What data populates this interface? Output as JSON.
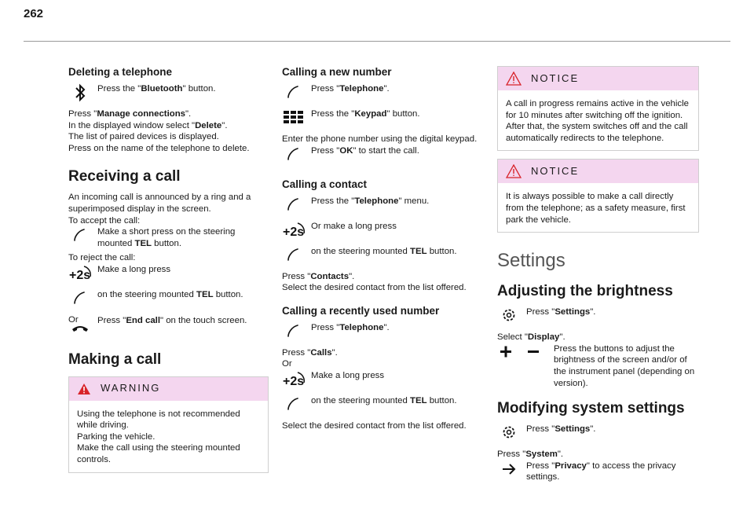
{
  "page_number": "262",
  "col1": {
    "deleting": {
      "title": "Deleting a telephone",
      "step1": "Press the \"<b>Bluetooth</b>\" button.",
      "para": "Press \"<b>Manage connections</b>\".<br>In the displayed window select \"<b>Delete</b>\".<br>The list of paired devices is displayed.<br>Press on the name of the telephone to delete."
    },
    "receiving": {
      "title": "Receiving a call",
      "para1": "An incoming call is announced by a ring and a superimposed display in the screen.<br>To accept the call:",
      "step1": "Make a short press on the steering mounted <b>TEL</b> button.",
      "reject": "To reject the call:",
      "step2": "Make a long press",
      "step3": "on the steering mounted <b>TEL</b> button.",
      "or": "Or",
      "step4": "Press \"<b>End call</b>\" on the touch screen."
    },
    "making": {
      "title": "Making a call",
      "warning_title": "WARNING",
      "warning_text": "Using the telephone is not recommended while driving.<br>Parking the vehicle.<br>Make the call using the steering mounted controls."
    }
  },
  "col2": {
    "new_number": {
      "title": "Calling a new number",
      "step1": "Press \"<b>Telephone</b>\".",
      "step2": "Press the \"<b>Keypad</b>\" button.",
      "para": "Enter the phone number using the digital keypad.",
      "step3": "Press \"<b>OK</b>\" to start the call."
    },
    "contact": {
      "title": "Calling a contact",
      "step1": "Press the \"<b>Telephone</b>\" menu.",
      "step2": "Or make a long press",
      "step3": "on the steering mounted <b>TEL</b> button.",
      "para": "Press \"<b>Contacts</b>\".<br>Select the desired contact from the list offered."
    },
    "recent": {
      "title": "Calling a recently used number",
      "step1": "Press \"<b>Telephone</b>\".",
      "para": "Press \"<b>Calls</b>\".<br>Or",
      "step2": "Make a long press",
      "step3": "on the steering mounted <b>TEL</b> button.",
      "para2": "Select the desired contact from the list offered."
    }
  },
  "col3": {
    "notice1_title": "NOTICE",
    "notice1_text": "A call in progress remains active in the vehicle for 10 minutes after switching off the ignition. After that, the system switches off and the call automatically redirects to the telephone.",
    "notice2_title": "NOTICE",
    "notice2_text": "It is always possible to make a call directly from the telephone; as a safety measure, first park the vehicle.",
    "settings_title": "Settings",
    "brightness": {
      "title": "Adjusting the brightness",
      "step1": "Press \"<b>Settings</b>\".",
      "para": "Select \"<b>Display</b>\".",
      "step2": "Press the buttons to adjust the brightness of the screen and/or of the instrument panel (depending on version)."
    },
    "system": {
      "title": "Modifying system settings",
      "step1": "Press \"<b>Settings</b>\".",
      "para": "Press \"<b>System</b>\".",
      "step2": "Press \"<b>Privacy</b>\" to access the privacy settings."
    }
  }
}
